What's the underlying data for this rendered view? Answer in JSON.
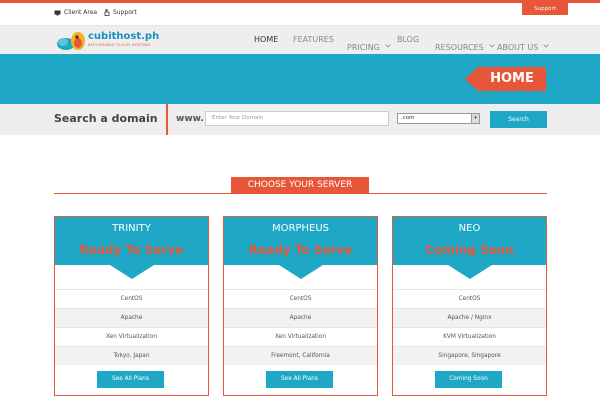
{
  "topbar": {
    "client_area": "Client Area",
    "support": "Support",
    "support_tab": "Support"
  },
  "brand": {
    "name": "cubithost.ph",
    "tagline": "AFFORDABLE CLOUD HOSTING",
    "primary_color": "#1fa8c6",
    "accent_color": "#e8563a"
  },
  "nav": {
    "items": [
      "HOME",
      "FEATURES",
      "PRICING",
      "BLOG",
      "RESOURCES",
      "ABOUT US"
    ],
    "active": "HOME"
  },
  "hero": {
    "badge": "HOME"
  },
  "search": {
    "title": "Search a domain",
    "prefix": "www.",
    "placeholder": "Enter Your Domain",
    "tld_selected": ".com",
    "button": "Search"
  },
  "servers": {
    "section_title": "CHOOSE YOUR SERVER",
    "cards": [
      {
        "name": "TRINITY",
        "status": "Ready To Serve",
        "features": [
          "CentOS",
          "Apache",
          "Xen Virtualization",
          "Tokyo, Japan"
        ],
        "button": "See All Plans"
      },
      {
        "name": "MORPHEUS",
        "status": "Ready To Serve",
        "features": [
          "CentOS",
          "Apache",
          "Xen Virtualization",
          "Freemont, California"
        ],
        "button": "See All Plans"
      },
      {
        "name": "NEO",
        "status": "Coming Soon",
        "features": [
          "CentOS",
          "Apache / Nginx",
          "KVM Virtualization",
          "Singapore, Singapore"
        ],
        "button": "Coming Soon"
      }
    ]
  }
}
